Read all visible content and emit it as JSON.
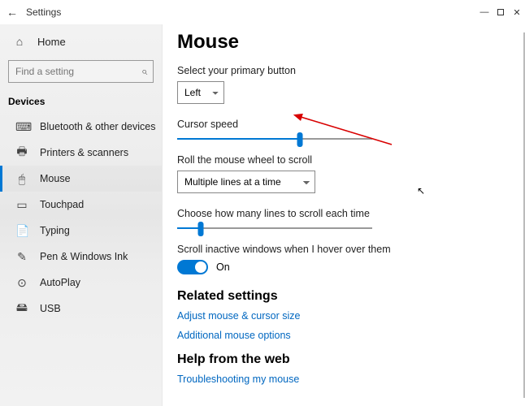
{
  "titlebar": {
    "back_icon": "←",
    "title": "Settings"
  },
  "sidebar": {
    "home_label": "Home",
    "search_placeholder": "Find a setting",
    "group_header": "Devices",
    "items": [
      {
        "label": "Bluetooth & other devices",
        "icon": "⌨"
      },
      {
        "label": "Printers & scanners",
        "icon": "🖶"
      },
      {
        "label": "Mouse",
        "icon": "🖱"
      },
      {
        "label": "Touchpad",
        "icon": "▭"
      },
      {
        "label": "Typing",
        "icon": "📄"
      },
      {
        "label": "Pen & Windows Ink",
        "icon": "✎"
      },
      {
        "label": "AutoPlay",
        "icon": "⊙"
      },
      {
        "label": "USB",
        "icon": "🖴"
      }
    ],
    "selected_index": 2
  },
  "content": {
    "page_title": "Mouse",
    "primary_button": {
      "label": "Select your primary button",
      "value": "Left"
    },
    "cursor_speed": {
      "label": "Cursor speed",
      "value": 63
    },
    "wheel_mode": {
      "label": "Roll the mouse wheel to scroll",
      "value": "Multiple lines at a time"
    },
    "lines_to_scroll": {
      "label": "Choose how many lines to scroll each time",
      "value": 12
    },
    "scroll_inactive": {
      "label": "Scroll inactive windows when I hover over them",
      "state": "On",
      "on": true
    },
    "related_header": "Related settings",
    "related_links": [
      "Adjust mouse & cursor size",
      "Additional mouse options"
    ],
    "help_header": "Help from the web",
    "help_links": [
      "Troubleshooting my mouse"
    ]
  }
}
